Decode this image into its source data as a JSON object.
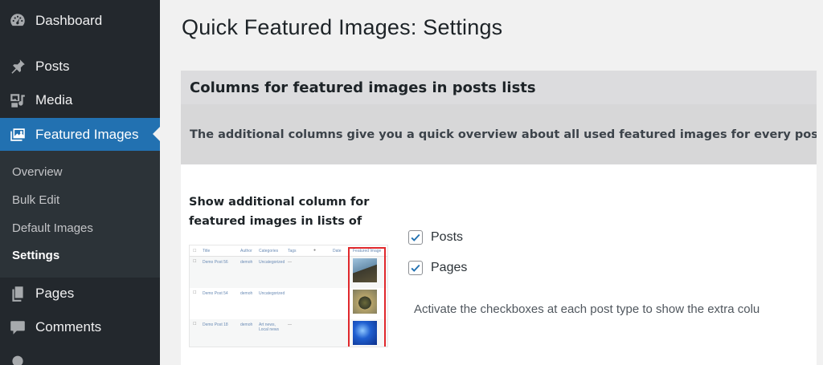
{
  "sidebar": {
    "items": [
      {
        "label": "Dashboard",
        "icon": "dashboard-icon"
      },
      {
        "label": "Posts",
        "icon": "pushpin-icon"
      },
      {
        "label": "Media",
        "icon": "media-icon"
      },
      {
        "label": "Featured Images",
        "icon": "featured-images-icon",
        "active": true
      },
      {
        "label": "Pages",
        "icon": "pages-icon"
      },
      {
        "label": "Comments",
        "icon": "comments-icon"
      }
    ],
    "submenu": [
      "Overview",
      "Bulk Edit",
      "Default Images",
      "Settings"
    ],
    "current_submenu": "Settings"
  },
  "page": {
    "title": "Quick Featured Images: Settings"
  },
  "section": {
    "heading": "Columns for featured images in posts lists",
    "description": "The additional columns give you a quick overview about all used featured images for every post. The Fe",
    "row_label_line1": "Show additional column for",
    "row_label_line2": "featured images in lists of",
    "checkboxes": [
      {
        "label": "Posts",
        "checked": true
      },
      {
        "label": "Pages",
        "checked": true
      }
    ],
    "hint": "Activate the checkboxes at each post type to show the extra colu"
  },
  "thumb": {
    "headers": [
      "Title",
      "Author",
      "Categories",
      "Tags",
      "Date",
      "Featured Image"
    ],
    "rows": [
      {
        "title": "Demo Post 56",
        "author": "demoh",
        "category": "Uncategorized",
        "tags": "—"
      },
      {
        "title": "Demo Post 54",
        "author": "demoh",
        "category": "Uncategorized",
        "tags": ""
      },
      {
        "title": "Demo Post 18",
        "author": "demoh",
        "category": "Art news, Local news",
        "tags": "—"
      }
    ]
  },
  "colors": {
    "sidebar_bg": "#23282d",
    "submenu_bg": "#2c3338",
    "active_bg": "#2271b1",
    "highlight_red": "#e0282c"
  }
}
